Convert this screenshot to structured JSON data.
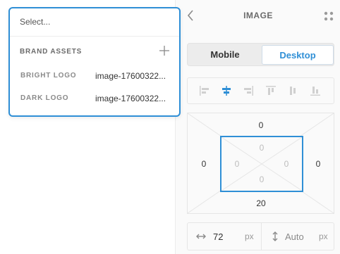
{
  "panel": {
    "title": "IMAGE",
    "device_toggle": {
      "mobile": "Mobile",
      "desktop": "Desktop",
      "active": "Desktop"
    },
    "alignment_options": [
      "align-left",
      "align-center-horizontal",
      "align-right",
      "align-top",
      "align-center-vertical",
      "align-bottom"
    ],
    "selected_alignment": "align-center-horizontal",
    "spacing": {
      "margin": {
        "top": "0",
        "right": "0",
        "bottom": "20",
        "left": "0"
      },
      "padding": {
        "top": "0",
        "right": "0",
        "bottom": "0",
        "left": "0"
      }
    },
    "size": {
      "width": {
        "value": "72",
        "unit": "px"
      },
      "height": {
        "value": "Auto",
        "unit": "px"
      }
    }
  },
  "popup": {
    "search_placeholder": "Select...",
    "section_title": "BRAND ASSETS",
    "assets": [
      {
        "label": "BRIGHT LOGO",
        "value": "image-17600322..."
      },
      {
        "label": "DARK LOGO",
        "value": "image-17600322..."
      }
    ]
  },
  "colors": {
    "accent": "#2f8fd6",
    "panel_bg": "#fafafa",
    "border": "#e6e6e6"
  }
}
